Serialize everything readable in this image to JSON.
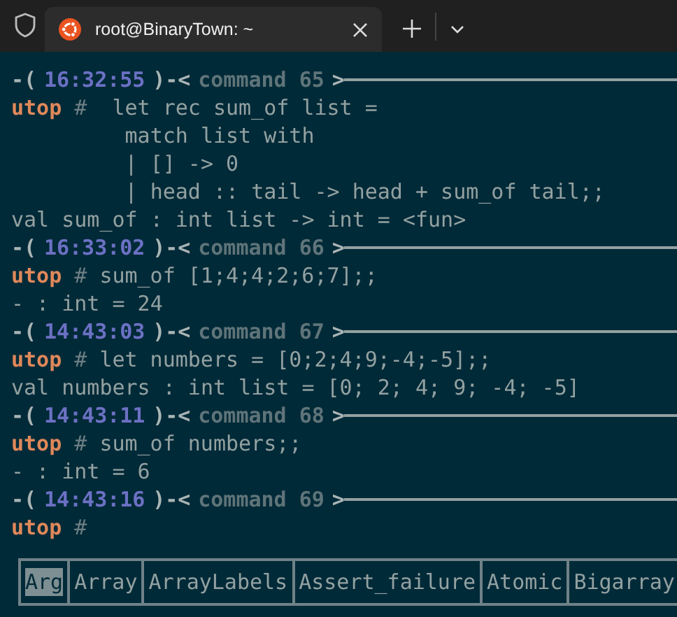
{
  "tab": {
    "title": "root@BinaryTown: ~",
    "selected": true
  },
  "lines": [
    {
      "kind": "header",
      "open": "-(",
      "time": "16:32:55",
      "mid": ")-<",
      "label": "command 65",
      "close": ">"
    },
    {
      "kind": "prompt",
      "prompt": "utop",
      "hash": "#",
      "code": " let rec sum_of list ="
    },
    {
      "kind": "continuation",
      "text": "match list with"
    },
    {
      "kind": "continuation",
      "text": "| [] -> 0"
    },
    {
      "kind": "continuation",
      "text": "| head :: tail -> head + sum_of tail;;"
    },
    {
      "kind": "output",
      "text": "val sum_of : int list -> int = <fun>"
    },
    {
      "kind": "header",
      "open": "-(",
      "time": "16:33:02",
      "mid": ")-<",
      "label": "command 66",
      "close": ">"
    },
    {
      "kind": "prompt",
      "prompt": "utop",
      "hash": "#",
      "code": "sum_of [1;4;4;2;6;7];;"
    },
    {
      "kind": "output",
      "text": "- : int = 24"
    },
    {
      "kind": "header",
      "open": "-(",
      "time": "14:43:03",
      "mid": ")-<",
      "label": "command 67",
      "close": ">"
    },
    {
      "kind": "prompt",
      "prompt": "utop",
      "hash": "#",
      "code": "let numbers = [0;2;4;9;-4;-5];;"
    },
    {
      "kind": "output",
      "text": "val numbers : int list = [0; 2; 4; 9; -4; -5]"
    },
    {
      "kind": "header",
      "open": "-(",
      "time": "14:43:11",
      "mid": ")-<",
      "label": "command 68",
      "close": ">"
    },
    {
      "kind": "prompt",
      "prompt": "utop",
      "hash": "#",
      "code": "sum_of numbers;;"
    },
    {
      "kind": "output",
      "text": "- : int = 6"
    },
    {
      "kind": "header",
      "open": "-(",
      "time": "14:43:16",
      "mid": ")-<",
      "label": "command 69",
      "close": ">"
    },
    {
      "kind": "prompt",
      "prompt": "utop",
      "hash": "#"
    }
  ],
  "completions": [
    {
      "label": "Arg",
      "selected": true
    },
    {
      "label": "Array",
      "selected": false
    },
    {
      "label": "ArrayLabels",
      "selected": false
    },
    {
      "label": "Assert_failure",
      "selected": false
    },
    {
      "label": "Atomic",
      "selected": false
    },
    {
      "label": "Bigarray",
      "selected": false
    }
  ]
}
